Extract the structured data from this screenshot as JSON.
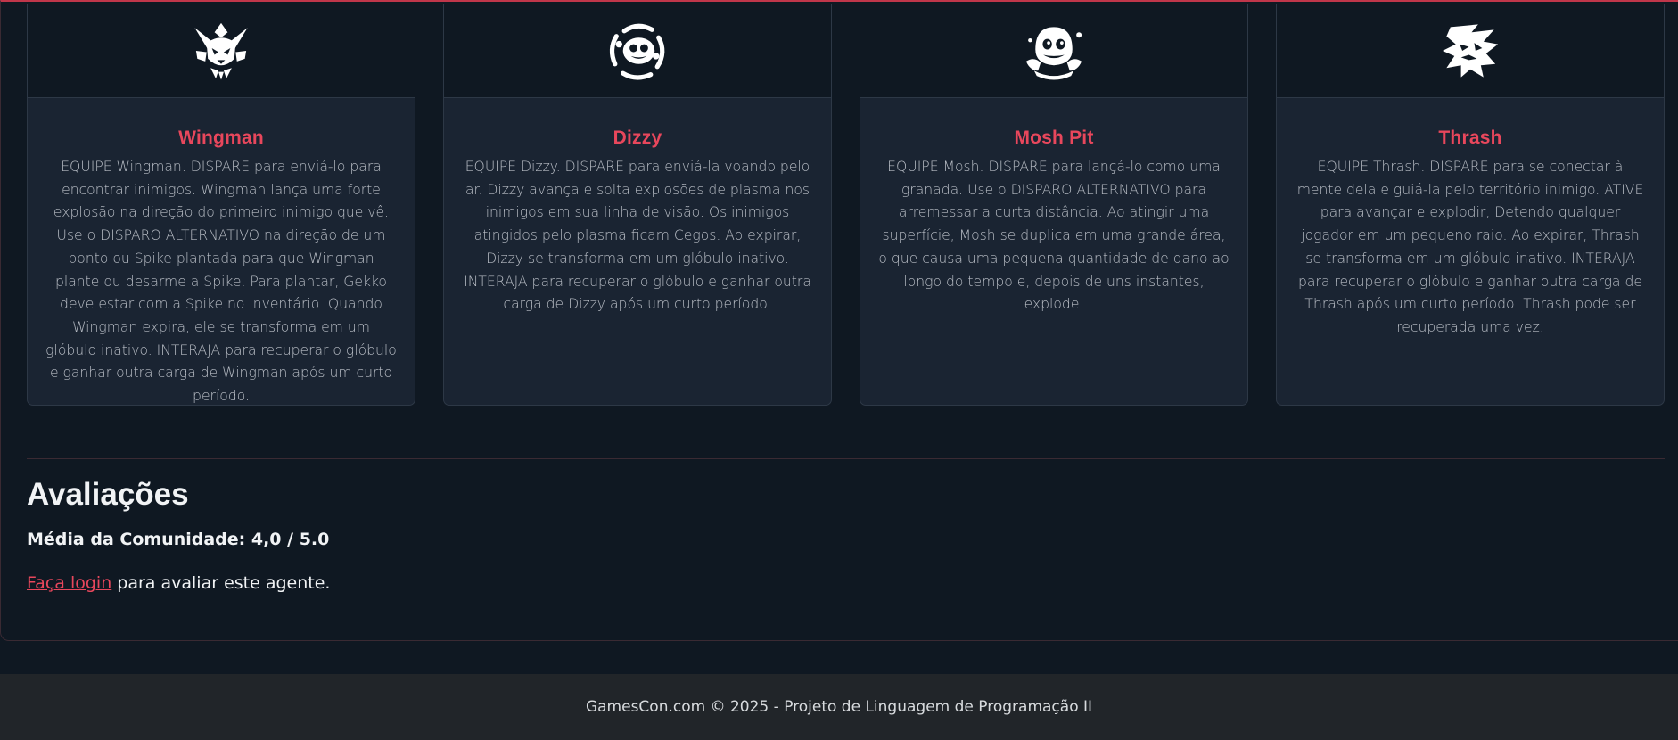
{
  "abilities": [
    {
      "name": "Wingman",
      "icon": "wingman-icon",
      "description": "EQUIPE Wingman. DISPARE para enviá-lo para encontrar inimigos. Wingman lança uma forte explosão na direção do primeiro inimigo que vê. Use o DISPARO ALTERNATIVO na direção de um ponto ou Spike plantada para que Wingman plante ou desarme a Spike. Para plantar, Gekko deve estar com a Spike no inventário. Quando Wingman expira, ele se transforma em um glóbulo inativo. INTERAJA para recuperar o glóbulo e ganhar outra carga de Wingman após um curto período."
    },
    {
      "name": "Dizzy",
      "icon": "dizzy-icon",
      "description": "EQUIPE Dizzy. DISPARE para enviá-la voando pelo ar. Dizzy avança e solta explosões de plasma nos inimigos em sua linha de visão. Os inimigos atingidos pelo plasma ficam Cegos. Ao expirar, Dizzy se transforma em um glóbulo inativo. INTERAJA para recuperar o glóbulo e ganhar outra carga de Dizzy após um curto período."
    },
    {
      "name": "Mosh Pit",
      "icon": "mosh-pit-icon",
      "description": "EQUIPE Mosh. DISPARE para lançá-lo como uma granada. Use o DISPARO ALTERNATIVO para arremessar a curta distância. Ao atingir uma superfície, Mosh se duplica em uma grande área, o que causa uma pequena quantidade de dano ao longo do tempo e, depois de uns instantes, explode."
    },
    {
      "name": "Thrash",
      "icon": "thrash-icon",
      "description": "EQUIPE Thrash. DISPARE para se conectar à mente dela e guiá-la pelo território inimigo. ATIVE para avançar e explodir, Detendo qualquer jogador em um pequeno raio. Ao expirar, Thrash se transforma em um glóbulo inativo. INTERAJA para recuperar o glóbulo e ganhar outra carga de Thrash após um curto período. Thrash pode ser recuperada uma vez."
    }
  ],
  "ratings": {
    "title": "Avaliações",
    "community_average": "Média da Comunidade: 4,0 / 5.0",
    "login_link": "Faça login",
    "login_suffix": " para avaliar este agente."
  },
  "footer": {
    "text": "GamesCon.com © 2025 - Projeto de Linguagem de Programação II"
  },
  "colors": {
    "accent": "#e8475c",
    "background": "#0f1822",
    "card": "#1a2432",
    "footer": "#212529"
  }
}
